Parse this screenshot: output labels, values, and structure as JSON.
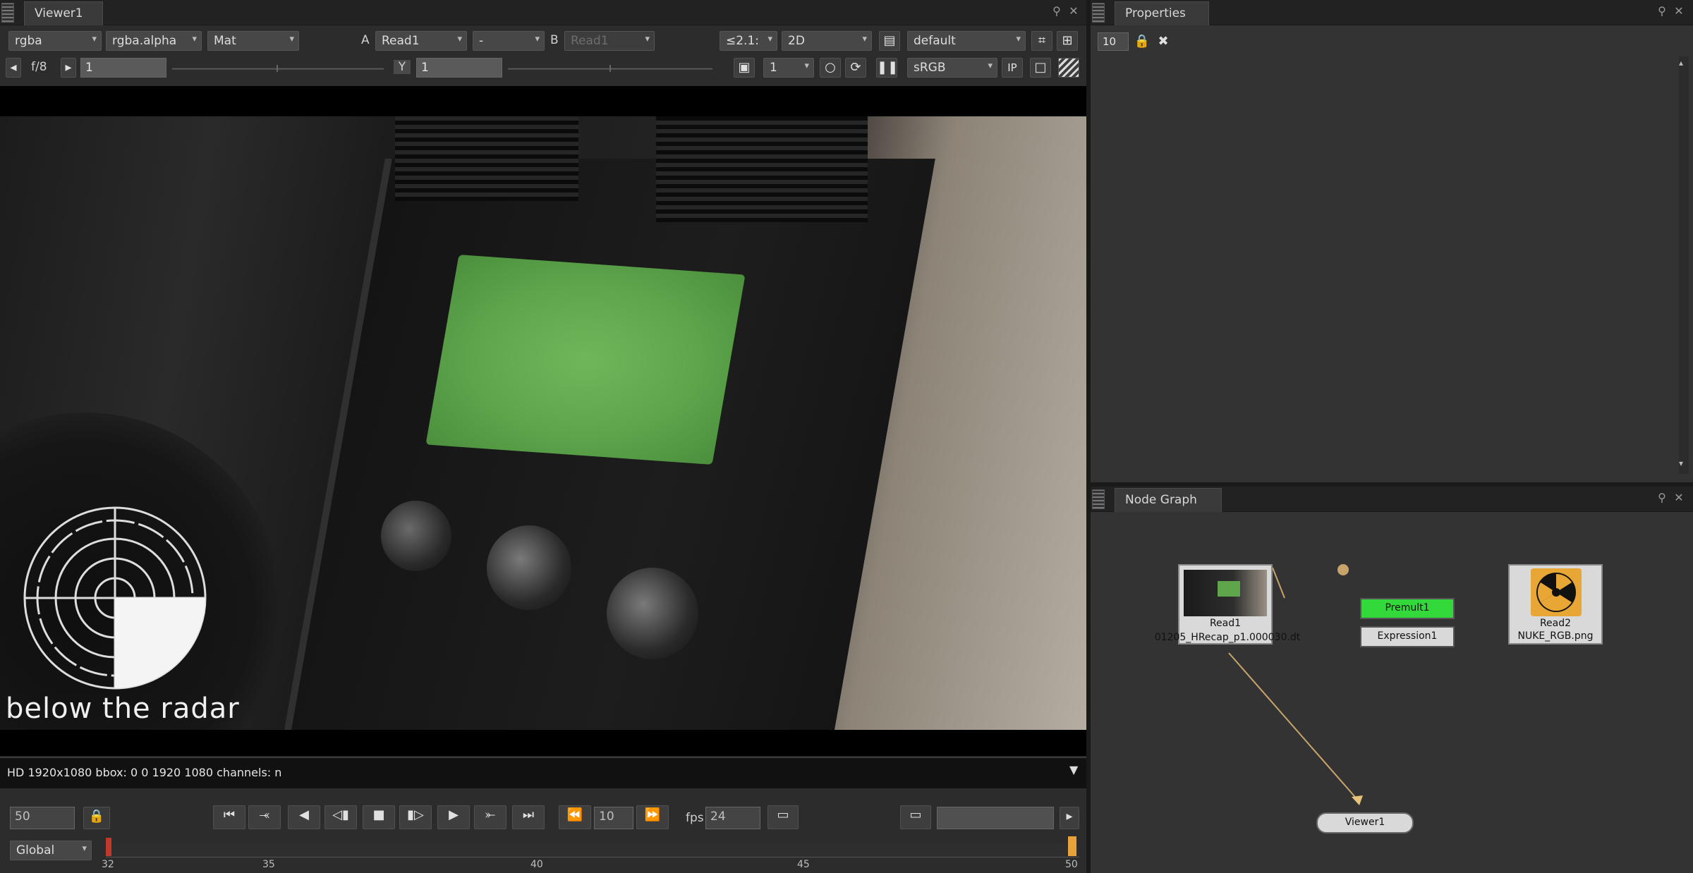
{
  "viewer": {
    "tab_title": "Viewer1",
    "toolbar_row1": {
      "channels": "rgba",
      "alpha_channel": "rgba.alpha",
      "matte": "Mat",
      "input_a_label": "A",
      "input_a_value": "Read1",
      "composite_mode": "-",
      "input_b_label": "B",
      "input_b_value": "Read1",
      "zoom": "≤2.1:",
      "view_mode": "2D",
      "lut": "default"
    },
    "toolbar_row2": {
      "fstop": "f/8",
      "gain_value": "1",
      "gamma_label": "Y",
      "gamma_value": "1",
      "proxy_value": "1",
      "colorspace": "sRGB",
      "ip_label": "IP"
    },
    "overlay_logo_text": "below the radar",
    "info_bar": "HD 1920x1080 bbox: 0 0 1920 1080 channels: n",
    "playback": {
      "current_frame": "50",
      "increment": "10",
      "fps_label": "fps",
      "fps_value": "24",
      "range_mode": "Global"
    },
    "timeline": {
      "ticks": [
        "32",
        "35",
        "40",
        "45",
        "50"
      ],
      "current": "50"
    }
  },
  "properties": {
    "tab_title": "Properties",
    "max_panels": "10"
  },
  "node_graph": {
    "tab_title": "Node Graph",
    "nodes": [
      {
        "name": "Read1",
        "subtitle": "01205_HRecap_p1.000030.dt"
      },
      {
        "name": "Premult1"
      },
      {
        "name": "Expression1"
      },
      {
        "name": "Read2",
        "subtitle": "NUKE_RGB.png"
      },
      {
        "name": "Viewer1"
      }
    ],
    "dot_label": "Dot"
  },
  "colors": {
    "panel_bg": "#323232",
    "premult_green": "#33d93a",
    "read_node_bg": "#d9d9d9",
    "link_color": "#c8a46a"
  }
}
